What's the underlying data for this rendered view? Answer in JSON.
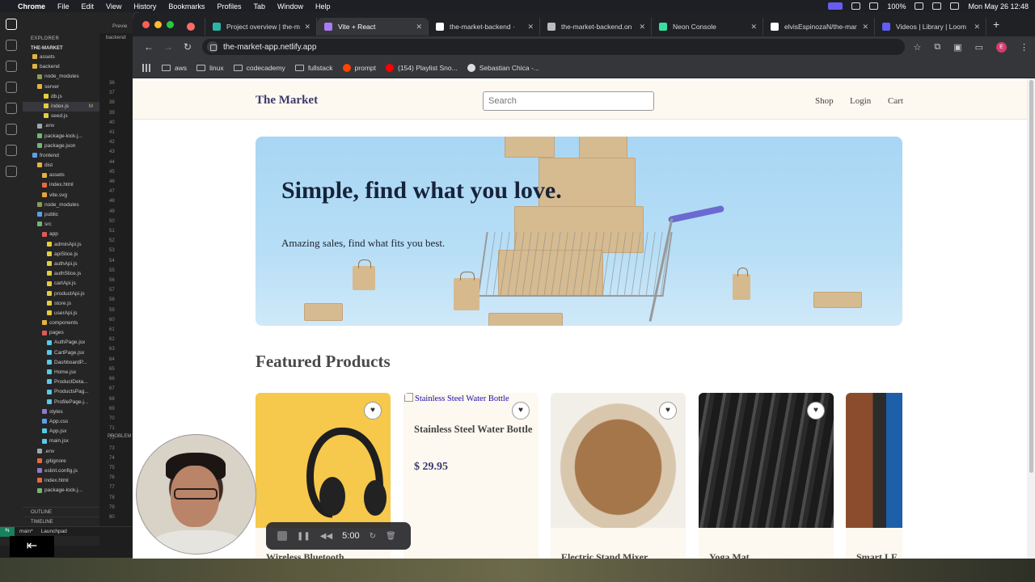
{
  "menubar": {
    "app": "Chrome",
    "items": [
      "File",
      "Edit",
      "View",
      "History",
      "Bookmarks",
      "Profiles",
      "Tab",
      "Window",
      "Help"
    ],
    "battery": "100%",
    "datetime": "Mon May 26  12:48"
  },
  "vscode": {
    "explorer_label": "EXPLORER",
    "preview_label": "Previe",
    "project": "THE-MARKET",
    "tab_sub": "backend",
    "tree": [
      {
        "label": "assets",
        "color": "#e2b340"
      },
      {
        "label": "backend",
        "color": "#e2b340"
      },
      {
        "label": "node_modules",
        "color": "#8d9a55"
      },
      {
        "label": "server",
        "color": "#e2b340"
      },
      {
        "label": "db.js",
        "color": "#e6cd3c"
      },
      {
        "label": "index.js",
        "color": "#e6cd3c",
        "mark": "M"
      },
      {
        "label": "seed.js",
        "color": "#e6cd3c"
      },
      {
        "label": ".env",
        "color": "#9aa"
      },
      {
        "label": "package-lock.j...",
        "color": "#6fb86f"
      },
      {
        "label": "package.json",
        "color": "#6fb86f"
      },
      {
        "label": "frontend",
        "color": "#5aa0e8"
      },
      {
        "label": "dist",
        "color": "#e2b340"
      },
      {
        "label": "assets",
        "color": "#e2b340"
      },
      {
        "label": "index.html",
        "color": "#e66b3c"
      },
      {
        "label": "vite.svg",
        "color": "#e6a33c"
      },
      {
        "label": "node_modules",
        "color": "#8d9a55"
      },
      {
        "label": "public",
        "color": "#5aa0e8"
      },
      {
        "label": "src",
        "color": "#6fb86f"
      },
      {
        "label": "app",
        "color": "#e05a5a"
      },
      {
        "label": "adminApi.js",
        "color": "#e6cd3c"
      },
      {
        "label": "apiSlice.js",
        "color": "#e6cd3c"
      },
      {
        "label": "authApi.js",
        "color": "#e6cd3c"
      },
      {
        "label": "authSlice.js",
        "color": "#e6cd3c"
      },
      {
        "label": "cartApi.js",
        "color": "#e6cd3c"
      },
      {
        "label": "productApi.js",
        "color": "#e6cd3c"
      },
      {
        "label": "store.js",
        "color": "#e6cd3c"
      },
      {
        "label": "userApi.js",
        "color": "#e6cd3c"
      },
      {
        "label": "components",
        "color": "#e2b340"
      },
      {
        "label": "pages",
        "color": "#e05a5a"
      },
      {
        "label": "AuthPage.jsx",
        "color": "#5ac8e8"
      },
      {
        "label": "CartPage.jsx",
        "color": "#5ac8e8"
      },
      {
        "label": "DashboardP...",
        "color": "#5ac8e8"
      },
      {
        "label": "Home.jsx",
        "color": "#5ac8e8"
      },
      {
        "label": "ProductDeta...",
        "color": "#5ac8e8"
      },
      {
        "label": "ProductsPag...",
        "color": "#5ac8e8"
      },
      {
        "label": "ProfilePage.j...",
        "color": "#5ac8e8"
      },
      {
        "label": "styles",
        "color": "#8d7ac8"
      },
      {
        "label": "App.css",
        "color": "#5aa0e8"
      },
      {
        "label": "App.jsx",
        "color": "#5ac8e8"
      },
      {
        "label": "main.jsx",
        "color": "#5ac8e8"
      },
      {
        "label": ".env",
        "color": "#9aa"
      },
      {
        "label": ".gitignore",
        "color": "#e66b3c"
      },
      {
        "label": "eslint.config.js",
        "color": "#8d7ac8"
      },
      {
        "label": "index.html",
        "color": "#e66b3c"
      },
      {
        "label": "package-lock.j...",
        "color": "#6fb86f"
      }
    ],
    "outline_label": "OUTLINE",
    "timeline_label": "TIMELINE",
    "line_numbers": [
      "36",
      "37",
      "38",
      "39",
      "40",
      "41",
      "42",
      "43",
      "44",
      "45",
      "46",
      "47",
      "48",
      "49",
      "50",
      "51",
      "52",
      "53",
      "54",
      "55",
      "56",
      "57",
      "58",
      "59",
      "60",
      "61",
      "62",
      "63",
      "64",
      "65",
      "66",
      "67",
      "68",
      "69",
      "70",
      "71",
      "72",
      "73",
      "74",
      "75",
      "76",
      "77",
      "78",
      "79",
      "80"
    ],
    "problems_label": "PROBLEM",
    "status_branch": "main*",
    "status_launchpad": "Launchpad"
  },
  "chrome": {
    "tabs": [
      {
        "label": "",
        "icon_color": "#ff6b6b",
        "icon_only": true
      },
      {
        "label": "Project overview | the-m",
        "icon_color": "#2bb5a6"
      },
      {
        "label": "Vite + React",
        "icon_color": "#a77bf3",
        "active": true
      },
      {
        "label": "the-market-backend ·",
        "icon_color": "#ffffff"
      },
      {
        "label": "the-market-backend.on",
        "icon_color": "#bbbbbb"
      },
      {
        "label": "Neon Console",
        "icon_color": "#38e0a0"
      },
      {
        "label": "elvisEspinozaN/the-mar",
        "icon_color": "#ffffff"
      },
      {
        "label": "Videos | Library | Loom",
        "icon_color": "#625df5"
      }
    ],
    "url": "the-market-app.netlify.app",
    "profile_initial": "E",
    "bookmarks": [
      {
        "label": "aws",
        "type": "folder"
      },
      {
        "label": "linux",
        "type": "folder"
      },
      {
        "label": "codecademy",
        "type": "folder"
      },
      {
        "label": "fullstack",
        "type": "folder"
      },
      {
        "label": "prompt",
        "type": "reddit",
        "color": "#ff4500"
      },
      {
        "label": "(154) Playlist Sno...",
        "type": "youtube",
        "color": "#ff0000"
      },
      {
        "label": "Sebastian Chica -...",
        "type": "site",
        "color": "#dddddd"
      }
    ]
  },
  "site": {
    "brand": "The Market",
    "search_placeholder": "Search",
    "nav": [
      "Shop",
      "Login",
      "Cart"
    ],
    "hero_title": "Simple, find what you love.",
    "hero_subtitle": "Amazing sales, find what fits you best.",
    "featured_title": "Featured Products",
    "products": [
      {
        "name": "Wireless Bluetooth",
        "image": "headphones",
        "has_image": true
      },
      {
        "name": "Stainless Steel Water Bottle",
        "alt": "Stainless Steel Water Bottle",
        "price": "$ 29.95",
        "has_image": false
      },
      {
        "name": "Electric Stand Mixer",
        "image": "bread",
        "has_image": true
      },
      {
        "name": "Yoga Mat",
        "image": "gym",
        "has_image": true
      },
      {
        "name": "Smart LE",
        "image": "tv",
        "has_image": true
      }
    ],
    "heart_icon": "♥"
  },
  "loom": {
    "timer": "5:00"
  }
}
